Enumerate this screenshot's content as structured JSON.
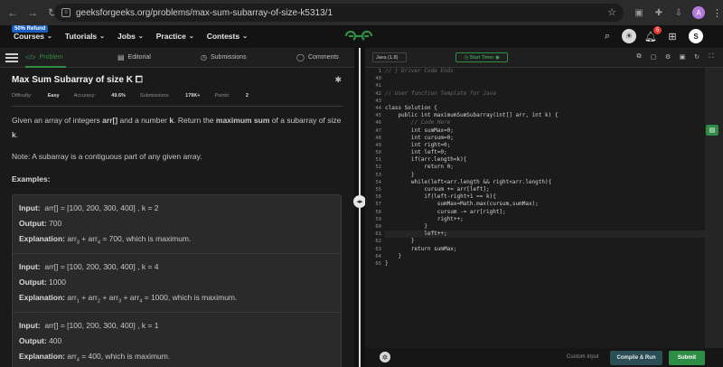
{
  "browser": {
    "url": "geeksforgeeks.org/problems/max-sum-subarray-of-size-k5313/1",
    "avatar_letter": "A"
  },
  "nav": {
    "refund_badge": "50% Refund",
    "items": [
      "Courses",
      "Tutorials",
      "Jobs",
      "Practice",
      "Contests"
    ],
    "notification_count": "5",
    "user_initial": "S",
    "logo_colors": {
      "green": "#2f8d46"
    }
  },
  "tabs": {
    "problem": "Problem",
    "editorial": "Editorial",
    "submissions": "Submissions",
    "comments": "Comments"
  },
  "problem": {
    "title": "Max Sum Subarray of size K",
    "difficulty_label": "Difficulty:",
    "difficulty": "Easy",
    "accuracy_label": "Accuracy:",
    "accuracy": "49.6%",
    "submissions_label": "Submissions:",
    "submissions": "179K+",
    "points_label": "Points:",
    "points": "2",
    "desc_1": "Given an array of integers ",
    "desc_arr": "arr[]",
    "desc_2": " and a number ",
    "desc_k": "k",
    "desc_3": ". Return the ",
    "desc_max": "maximum sum",
    "desc_4": " of a subarray of size ",
    "desc_k2": "k",
    "desc_5": ".",
    "note": "Note: A subarray is a contiguous part of any given array.",
    "examples_heading": "Examples:",
    "examples": [
      {
        "input": "arr[] = [100, 200, 300, 400] , k = 2",
        "output": "700",
        "explanation_parts": [
          "arr",
          "3",
          " + arr",
          "4",
          " = 700,  which  is  maximum."
        ]
      },
      {
        "input": "arr[] = [100, 200, 300, 400] , k = 4",
        "output": "1000",
        "explanation_parts": [
          "arr",
          "1",
          " + arr",
          "2",
          " + arr",
          "3",
          " + arr",
          "4",
          " = 1000,  which  is  maximum."
        ]
      },
      {
        "input": "arr[] = [100, 200, 300, 400] , k = 1",
        "output": "400",
        "explanation_parts": [
          "arr",
          "4",
          " = 400,  which  is  maximum."
        ]
      }
    ],
    "labels": {
      "input": "Input:",
      "output": "Output:",
      "explanation": "Explanation:"
    }
  },
  "editor": {
    "language": "Java (1.8)",
    "timer_label": "Start Timer",
    "line_numbers": [
      "1",
      "40",
      "41",
      "42",
      "43",
      "44",
      "45",
      "46",
      "47",
      "48",
      "49",
      "50",
      "51",
      "52",
      "53",
      "54",
      "55",
      "56",
      "57",
      "58",
      "59",
      "60",
      "61",
      "62",
      "63",
      "64",
      "65"
    ],
    "lines": [
      "// } Driver Code Ends",
      "",
      "",
      "// User function Template for Java",
      "",
      "class Solution {",
      "    public int maximumSumSubarray(int[] arr, int k) {",
      "        // Code Here",
      "        int sumMax=0;",
      "        int cursum=0;",
      "        int right=0;",
      "        int left=0;",
      "        if(arr.length<k){",
      "            return 0;",
      "        }",
      "        while(left<arr.length && right<arr.length){",
      "            cursum += arr[left];",
      "            if(left-right+1 == k){",
      "                sumMax=Math.max(cursum,sumMax);",
      "                cursum -= arr[right];",
      "                right++;",
      "            }",
      "            left++;",
      "        }",
      "        return sumMax;",
      "    }",
      "}"
    ],
    "custom_input": "Custom Input",
    "compile_label": "Compile & Run",
    "submit_label": "Submit"
  }
}
